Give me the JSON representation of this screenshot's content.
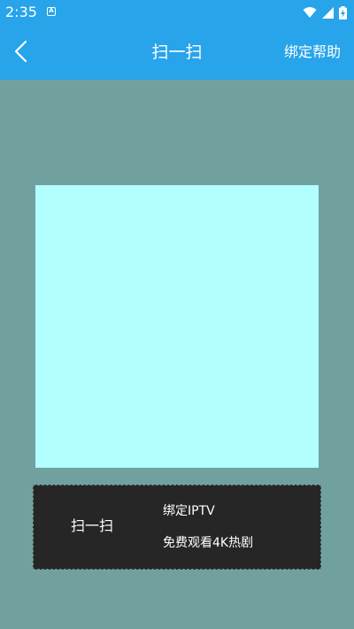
{
  "status_bar": {
    "time": "2:35",
    "notification_icon": "a-box-icon",
    "right_icons": [
      "wifi-icon",
      "signal-icon",
      "battery-charging-icon"
    ]
  },
  "app_bar": {
    "back_icon": "chevron-left-icon",
    "title": "扫一扫",
    "help_label": "绑定帮助"
  },
  "panel": {
    "scan_label": "扫一扫",
    "line1": "绑定IPTV",
    "line2": "免费观看4K热剧"
  },
  "colors": {
    "app_bar": "#27A4EA",
    "background": "#70A19F",
    "scan_frame": "#B1FFFF",
    "panel": "#262626"
  }
}
